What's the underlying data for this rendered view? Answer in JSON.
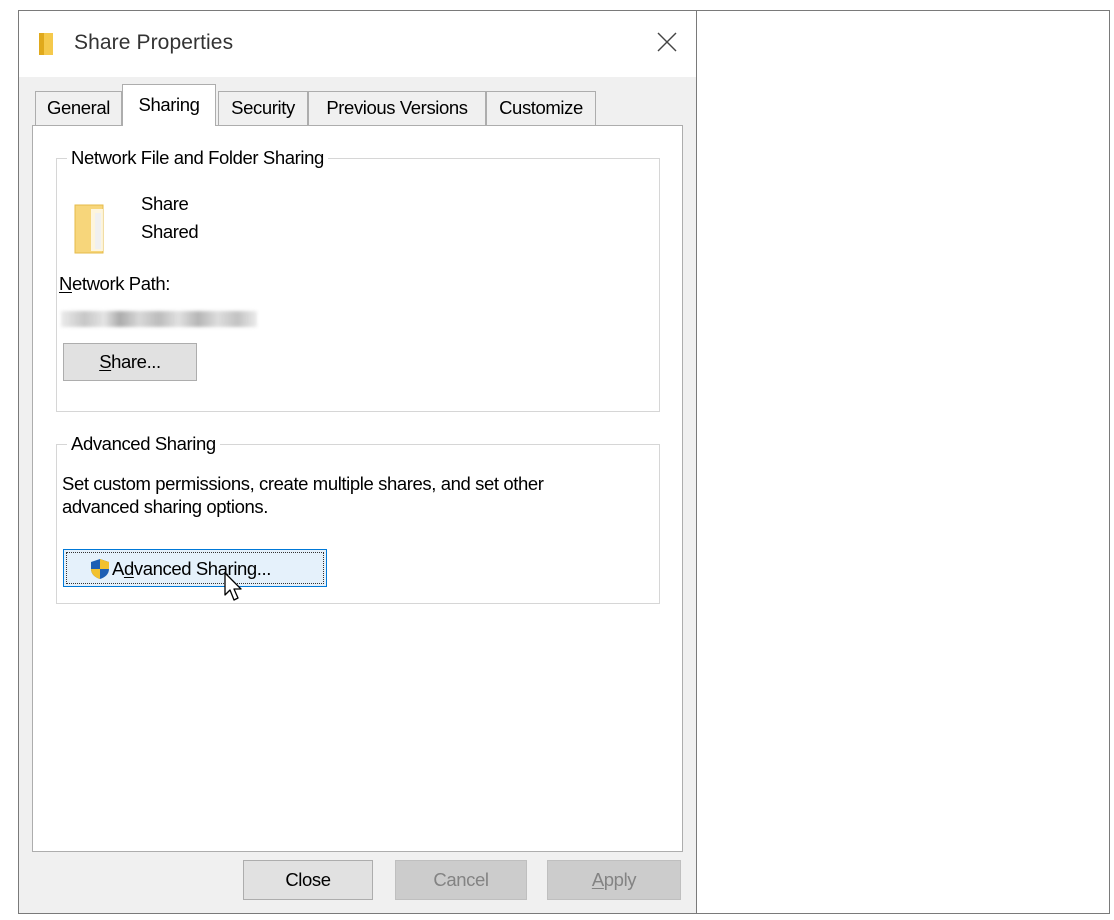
{
  "window": {
    "title": "Share Properties",
    "icons": {
      "title": "folder-icon",
      "close": "close-icon"
    }
  },
  "tabs": [
    {
      "label": "General",
      "selected": false
    },
    {
      "label": "Sharing",
      "selected": true
    },
    {
      "label": "Security",
      "selected": false
    },
    {
      "label": "Previous Versions",
      "selected": false
    },
    {
      "label": "Customize",
      "selected": false
    }
  ],
  "network_sharing": {
    "legend": "Network File and Folder Sharing",
    "folder_name": "Share",
    "folder_status": "Shared",
    "path_label_accel": "N",
    "path_label_rest": "etwork Path:",
    "share_button_accel": "S",
    "share_button_rest": "hare..."
  },
  "advanced_sharing": {
    "legend": "Advanced Sharing",
    "description_line1": "Set custom permissions, create multiple shares, and set other",
    "description_line2": "advanced sharing options.",
    "button_pre": "A",
    "button_accel": "d",
    "button_rest": "vanced Sharing...",
    "button_icon": "uac-shield-icon"
  },
  "footer": {
    "close_label": "Close",
    "cancel_label": "Cancel",
    "apply_accel": "A",
    "apply_rest": "pply"
  },
  "colors": {
    "dialog_bg": "#f0f0f0",
    "panel_bg": "#ffffff",
    "default_button_border": "#0078d7",
    "folder_yellow": "#f5c94c",
    "shield_blue": "#1e5fb4",
    "shield_yellow": "#f2c12e"
  }
}
